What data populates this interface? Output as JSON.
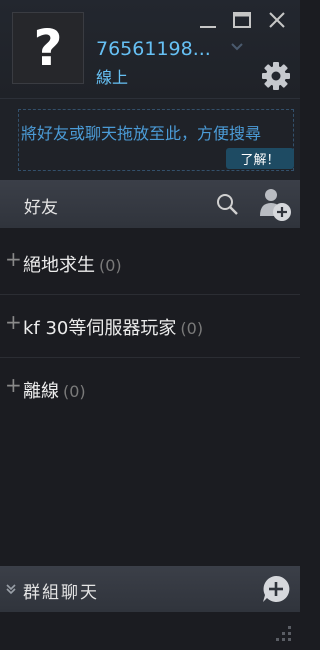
{
  "window": {
    "controls": [
      "minimize-icon",
      "maximize-icon",
      "close-icon"
    ]
  },
  "profile": {
    "avatar_glyph": "?",
    "username": "76561198...",
    "status": "線上",
    "accent": "#66c0f4"
  },
  "dropzone": {
    "text": "將好友或聊天拖放至此，方便搜尋",
    "button": "了解！"
  },
  "friends": {
    "title": "好友",
    "icons": [
      "search-icon",
      "add-friend-icon"
    ]
  },
  "groups": [
    {
      "name": "絕地求生",
      "count": "(0)"
    },
    {
      "name": "kf 30等伺服器玩家",
      "count": "(0)"
    },
    {
      "name": "離線",
      "count": "(0)"
    }
  ],
  "group_chats": {
    "title": "群組聊天",
    "icons": [
      "chevron-down-icon",
      "add-chat-icon"
    ]
  }
}
